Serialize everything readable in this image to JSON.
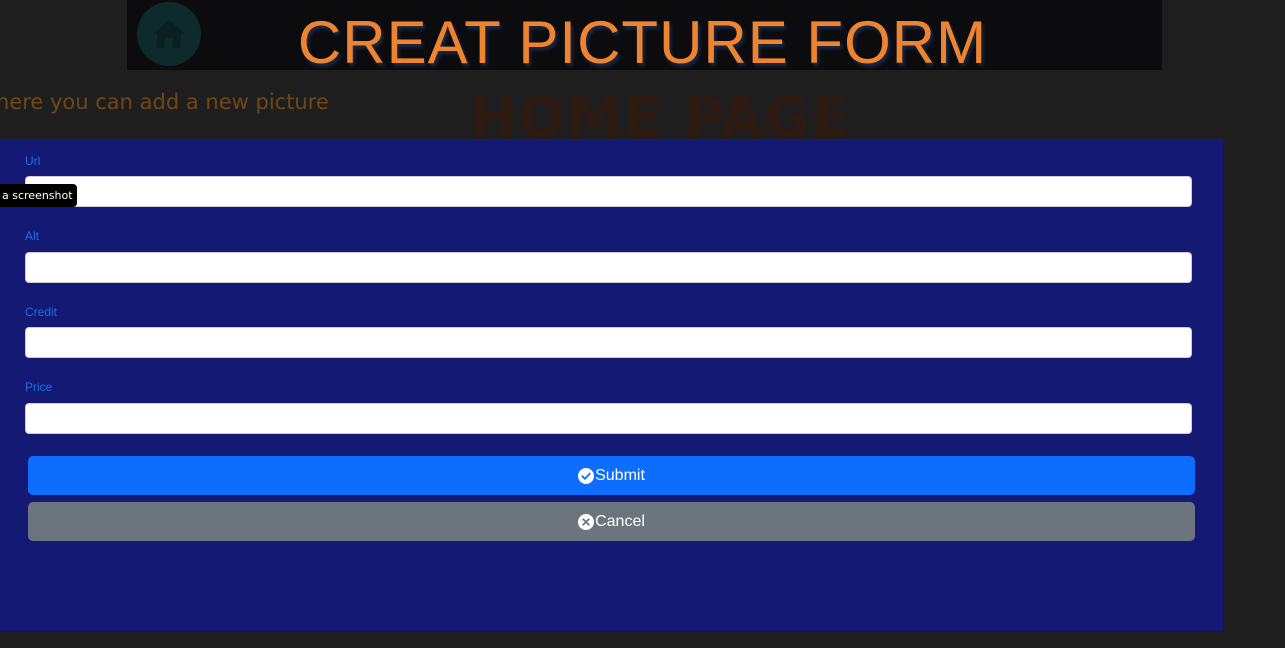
{
  "header": {
    "title": "CREAT PICTURE FORM",
    "subtitle": "here you can add a new picture"
  },
  "background": {
    "home_title": "HOME PAGE"
  },
  "form": {
    "fields": [
      {
        "label": "Url",
        "value": "",
        "placeholder": ""
      },
      {
        "label": "Alt",
        "value": "",
        "placeholder": ""
      },
      {
        "label": "Credit",
        "value": "",
        "placeholder": ""
      },
      {
        "label": "Price",
        "value": "",
        "placeholder": ""
      }
    ],
    "submit_label": "Submit",
    "cancel_label": "Cancel"
  },
  "tooltip": {
    "text": "a screenshot"
  },
  "colors": {
    "title": "#ee8430",
    "panel": "#141a74",
    "label": "#1b6fe6",
    "submit": "#0d6efd",
    "cancel": "#6c757d"
  },
  "icons": {
    "home": "home-icon",
    "submit": "check-circle-icon",
    "cancel": "x-circle-icon"
  }
}
